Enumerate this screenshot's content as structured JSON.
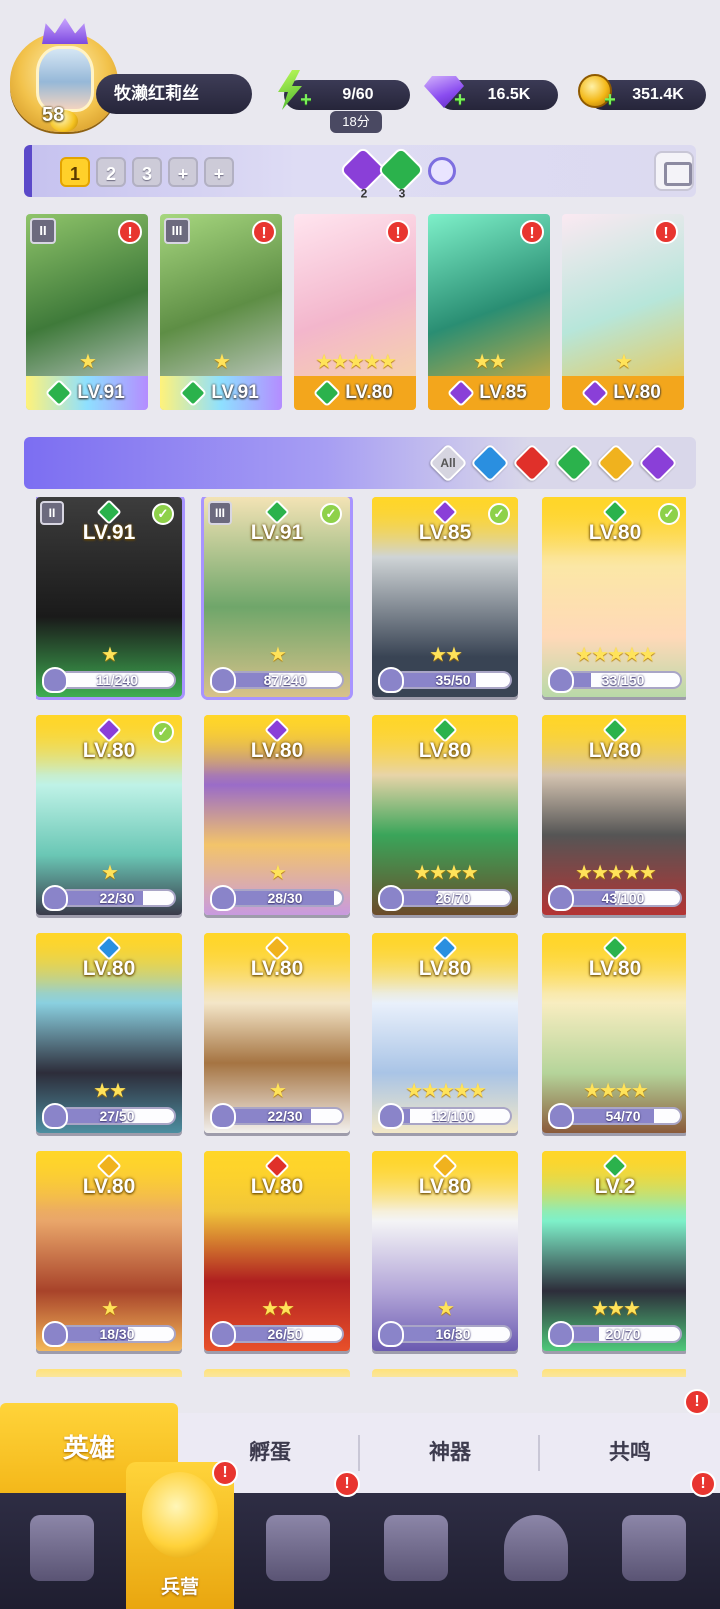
{
  "player": {
    "level": "58",
    "name": "牧濑红莉丝"
  },
  "resources": {
    "energy": "9/60",
    "energy_timer": "18分",
    "gems": "16.5K",
    "gold": "351.4K"
  },
  "team_bar": {
    "teams": [
      "1",
      "2",
      "3",
      "+",
      "+"
    ],
    "active_team": "1",
    "element_counts": [
      "2",
      "3"
    ]
  },
  "team_slots": [
    {
      "level": "LV.91",
      "element": "forest",
      "rank": "II",
      "alert": "!",
      "stars": "★"
    },
    {
      "level": "LV.91",
      "element": "forest",
      "rank": "III",
      "alert": "!",
      "stars": "★"
    },
    {
      "level": "LV.80",
      "element": "forest",
      "alert": "!",
      "stars": "★★★★★"
    },
    {
      "level": "LV.85",
      "element": "dark",
      "alert": "!",
      "stars": "★★"
    },
    {
      "level": "LV.80",
      "element": "dark",
      "alert": "!",
      "stars": "★"
    }
  ],
  "filter": {
    "all_label": "All",
    "elements": [
      "water",
      "fire",
      "forest",
      "light",
      "dark"
    ]
  },
  "heroes": [
    {
      "level": "LV.91",
      "element": "forest",
      "progress": "11/240",
      "ratio": 0.05,
      "checked": true,
      "rank": "II",
      "stars": "★"
    },
    {
      "level": "LV.91",
      "element": "forest",
      "progress": "87/240",
      "ratio": 0.36,
      "checked": true,
      "rank": "III",
      "stars": "★"
    },
    {
      "level": "LV.85",
      "element": "dark",
      "progress": "35/50",
      "ratio": 0.7,
      "checked": true,
      "stars": "★★"
    },
    {
      "level": "LV.80",
      "element": "forest",
      "progress": "33/150",
      "ratio": 0.22,
      "checked": true,
      "stars": "★★★★★"
    },
    {
      "level": "LV.80",
      "element": "dark",
      "progress": "22/30",
      "ratio": 0.73,
      "checked": true,
      "stars": "★"
    },
    {
      "level": "LV.80",
      "element": "dark",
      "progress": "28/30",
      "ratio": 0.93,
      "checked": false,
      "stars": "★"
    },
    {
      "level": "LV.80",
      "element": "forest",
      "progress": "26/70",
      "ratio": 0.37,
      "checked": false,
      "stars": "★★★★"
    },
    {
      "level": "LV.80",
      "element": "forest",
      "progress": "43/100",
      "ratio": 0.43,
      "checked": false,
      "stars": "★★★★★"
    },
    {
      "level": "LV.80",
      "element": "water",
      "progress": "27/50",
      "ratio": 0.54,
      "checked": false,
      "stars": "★★"
    },
    {
      "level": "LV.80",
      "element": "light",
      "progress": "22/30",
      "ratio": 0.73,
      "checked": false,
      "stars": "★"
    },
    {
      "level": "LV.80",
      "element": "water",
      "progress": "12/100",
      "ratio": 0.12,
      "checked": false,
      "stars": "★★★★★"
    },
    {
      "level": "LV.80",
      "element": "forest",
      "progress": "54/70",
      "ratio": 0.77,
      "checked": false,
      "stars": "★★★★"
    },
    {
      "level": "LV.80",
      "element": "light",
      "progress": "18/30",
      "ratio": 0.6,
      "checked": false,
      "stars": "★"
    },
    {
      "level": "LV.80",
      "element": "fire",
      "progress": "26/50",
      "ratio": 0.52,
      "checked": false,
      "stars": "★★"
    },
    {
      "level": "LV.80",
      "element": "light",
      "progress": "16/30",
      "ratio": 0.53,
      "checked": false,
      "stars": "★"
    },
    {
      "level": "LV.2",
      "element": "forest",
      "progress": "20/70",
      "ratio": 0.29,
      "checked": false,
      "stars": "★★★"
    }
  ],
  "subtabs": [
    "英雄",
    "孵蛋",
    "神器",
    "共鸣"
  ],
  "nav": {
    "active_label": "兵营",
    "items": [
      "cards-icon",
      "barracks-icon",
      "map-book-icon",
      "castle-icon",
      "mushroom-house-icon",
      "guild-banner-icon"
    ]
  },
  "colors": {
    "forest": "#2bb24c",
    "water": "#2a8fe0",
    "fire": "#e0302a",
    "light": "#f0b21e",
    "dark": "#8a3fd8",
    "accent": "#ffd02a"
  }
}
